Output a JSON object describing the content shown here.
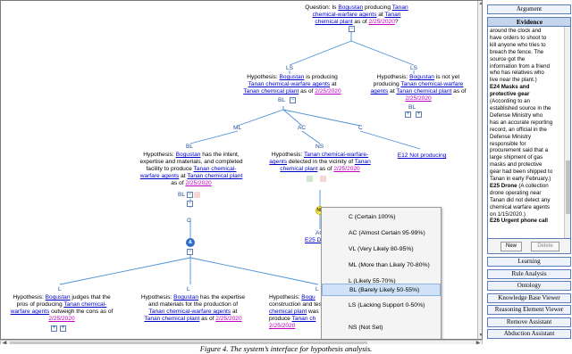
{
  "tree": {
    "question": {
      "prefix": "Question: Is ",
      "agent": "Bogustan",
      "mid": " producing ",
      "object1": "Tanan",
      "object2": "chemical-warfare agents",
      "at": " at ",
      "place": "Tanan chemical plant",
      "asof": " as of ",
      "date": "2/25/2020",
      "q": "?"
    },
    "labels": {
      "ls_left": "LS",
      "ls_right": "LS",
      "bl_left": "BL",
      "bl_right": "BL",
      "ml": "ML",
      "ac": "AC",
      "c_mid": "C",
      "bl_ml": "BL",
      "ns": "NS",
      "bl_ml_sub": "BL",
      "c_low": "C",
      "bl_low": "BL",
      "l_left": "L",
      "l_mid": "L",
      "l_right": "L",
      "nb": "NB",
      "ac_e25": "AC"
    },
    "hyp_producing": {
      "line1a": "Hypothesis: ",
      "line1b": "Bogustan",
      "line1c": " is producing",
      "line2": "Tanan chemical-warfare agents",
      "line2b": " at",
      "line3": "Tanan chemical plant",
      "line3b": " as of ",
      "date": "2/25/2020"
    },
    "hyp_not_yet": {
      "line1a": "Hypothesis: ",
      "line1b": "Bogustan",
      "line1c": " is not yet",
      "line2a": "producing ",
      "line2b": "Tanan chemical-warfare",
      "line3a": "agents",
      "line3b": " at ",
      "line3c": "Tanan chemical plant",
      "line3d": " as of",
      "date": "2/25/2020"
    },
    "hyp_intent": {
      "line1a": "Hypothesis: ",
      "line1b": "Bogustan",
      "line1c": " has the intent,",
      "line2": "expertise and materials, and completed",
      "line3": "facility to produce ",
      "line3b": "Tanan chemical-",
      "line4a": "warfare agents",
      "line4b": " at ",
      "line4c": "Tanan chemical plant",
      "line5": "as of ",
      "date": "2/25/2020"
    },
    "hyp_detected": {
      "line1a": "Hypothesis: ",
      "line1b": "Tanan chemical-warfare-",
      "line2a": "agents",
      "line2b": " detected in the vicinity of ",
      "line2c": "Tanan",
      "line3a": "chemical plant",
      "line3b": " as of ",
      "date": "2/25/2020"
    },
    "e12": "E12 Not producing",
    "e25": "E25 Dr",
    "hyp_judges": {
      "line1a": "Hypothesis: ",
      "line1b": "Bogustan",
      "line1c": " judges that the",
      "line2a": "pros of producing ",
      "line2b": "Tanan chemical-",
      "line3a": "warfare agents",
      "line3b": " outweigh the cons as of",
      "date": "2/25/2020"
    },
    "hyp_expertise": {
      "line1a": "Hypothesis: ",
      "line1b": "Bogustan",
      "line1c": " has the expertise",
      "line2": "and materials for the production of",
      "line3a": "Tanan chemical-warfare agents",
      "line3b": " at",
      "line4a": "Tanan chemical plant",
      "line4b": " as of ",
      "date": "2/25/2020"
    },
    "hyp_construction": {
      "line1a": "Hypothesis: ",
      "line1b": "Bogu",
      "line2": "construction and test",
      "line3": "chemical plant",
      "line3b": " was",
      "line4": "produce ",
      "line4b": "Tanan ch",
      "date": "2/25/2020"
    }
  },
  "context_menu": {
    "items": [
      {
        "label": "C (Certain 100%)",
        "selected": false
      },
      {
        "label": "AC (Almost Certain 95-99%)",
        "selected": false
      },
      {
        "label": "VL (Very Likely 80-95%)",
        "selected": false
      },
      {
        "label": "ML (More than Likely 70-80%)",
        "selected": false
      },
      {
        "label": "L (Likely 55-70%)",
        "selected": false
      },
      {
        "label": "BL (Barely Likely 50-55%)",
        "selected": true
      },
      {
        "label": "LS (Lacking Support 0-50%)",
        "selected": false
      },
      {
        "label": "NS (Not Set)",
        "selected": false
      }
    ]
  },
  "right_panel": {
    "argument": "Argument",
    "evidence_title": "Evidence",
    "evidence_lines": [
      "around the clock and",
      "have orders to shoot to",
      "kill anyone who tries to",
      "breach the fence. The",
      "source got the",
      "information from a friend",
      "who has relatives who",
      "live near the plant.)"
    ],
    "e24_title1": "E24 Masks and",
    "e24_title2": "protective gear",
    "e24_lines": [
      "(According to an",
      "established source in the",
      "Defense Ministry who",
      "has an accurate reporting",
      "record, an official in the",
      "Defense Ministry",
      "responsible for",
      "procurement said that a",
      "large shipment of gas",
      "masks and protective",
      "gear had been shipped to",
      "Tanan in early February.)"
    ],
    "e25_title": "E25 Drone",
    "e25_rest": " (A collection",
    "e25_lines": [
      "drone operating near",
      "Tanan did not detect any",
      "chemical warfare agents",
      "on 1/15/2020.)"
    ],
    "e26_partial": "E26 Urgent phone call",
    "new_btn": "New",
    "delete_btn": "Delete",
    "buttons": [
      "Learning",
      "Rule Analysis",
      "Ontology",
      "Knowledge Base Viewer",
      "Reasoning Element Viewer",
      "Remove Assistant",
      "Abduction Assistant"
    ]
  },
  "caption": "Figure 4. The system’s interface for hypothesis analysis.",
  "colors": {
    "link": "#0000cc",
    "date": "#c000c0",
    "line": "#4a90d9",
    "label": "#1f4e99",
    "menu_selected": "#cfe2f7"
  }
}
